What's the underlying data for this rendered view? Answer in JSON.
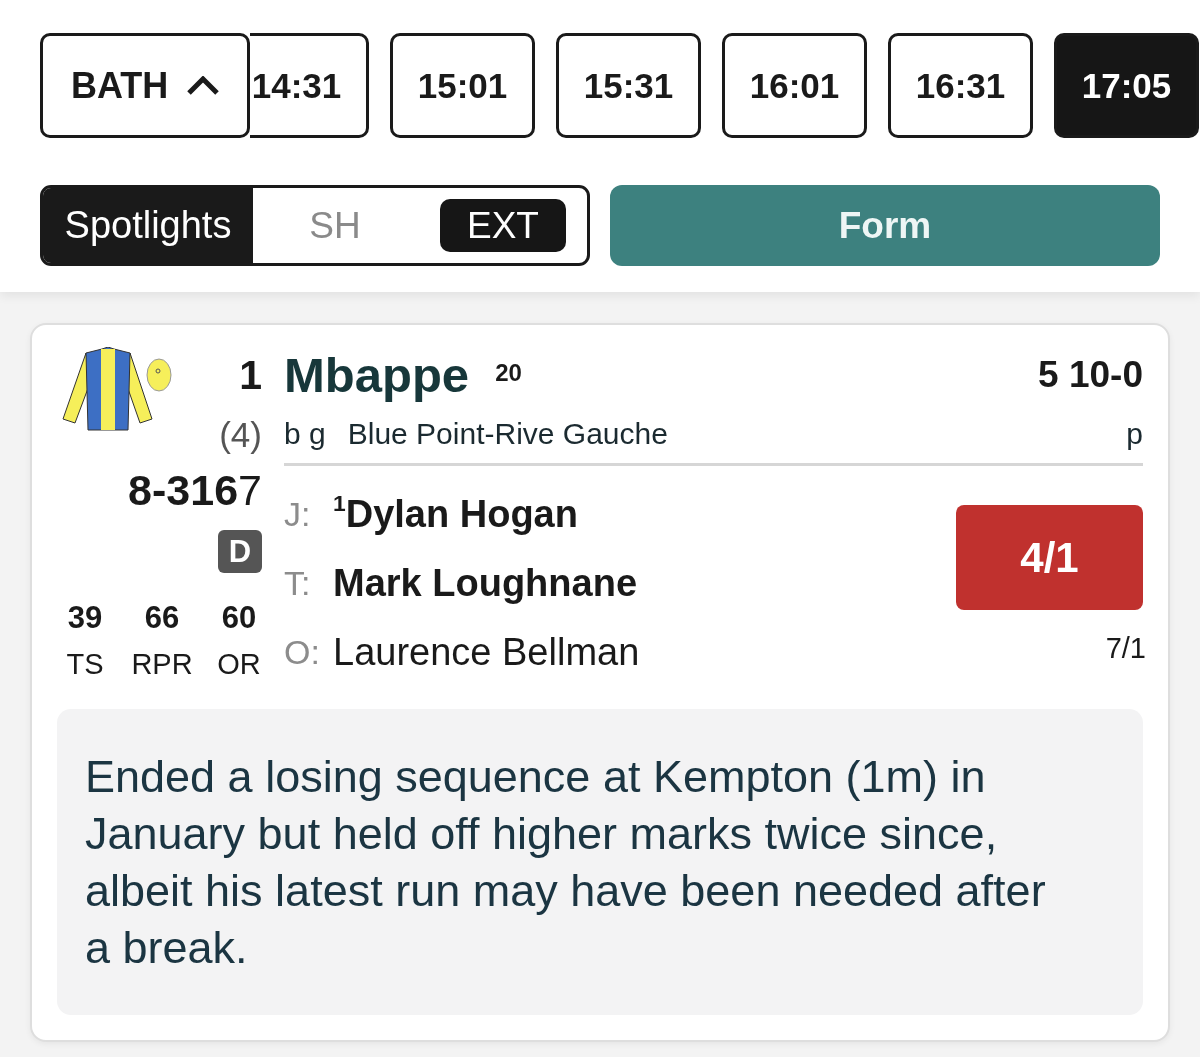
{
  "meeting_selector": {
    "label": "BATH",
    "expanded": true
  },
  "race_times": [
    {
      "time": "14:31",
      "selected": false
    },
    {
      "time": "15:01",
      "selected": false
    },
    {
      "time": "15:31",
      "selected": false
    },
    {
      "time": "16:01",
      "selected": false
    },
    {
      "time": "16:31",
      "selected": false
    },
    {
      "time": "17:05",
      "selected": true
    }
  ],
  "view_toggle": {
    "label": "Spotlights",
    "options": [
      {
        "label": "SH",
        "selected": false
      },
      {
        "label": "EXT",
        "selected": true
      }
    ]
  },
  "form_button": {
    "label": "Form"
  },
  "runner": {
    "number": "1",
    "draw": "(4)",
    "form": "**8-316**7",
    "badges": [
      "D"
    ],
    "stats": [
      {
        "value": "39",
        "label": "TS"
      },
      {
        "value": "66",
        "label": "RPR"
      },
      {
        "value": "60",
        "label": "OR"
      }
    ],
    "name": "Mbappe",
    "days_since_run": "20",
    "age_weight": "5 10-0",
    "sex": "b g",
    "pedigree": "Blue Point-Rive Gauche",
    "headgear": "p",
    "connections": [
      {
        "kind": "jockey",
        "label": "J:",
        "name": "$^{1}$Dylan Hogan"
      },
      {
        "kind": "trainer",
        "label": "T:",
        "name": "Mark Loughnane"
      },
      {
        "kind": "owner",
        "label": "O:",
        "name": "Laurence Bellman"
      }
    ],
    "odds": "4/1",
    "previous_odds": "7/1",
    "comment": "Ended a losing sequence at Kempton (1m) in January but held off higher marks twice since, albeit his latest run may have been needed after a break."
  }
}
